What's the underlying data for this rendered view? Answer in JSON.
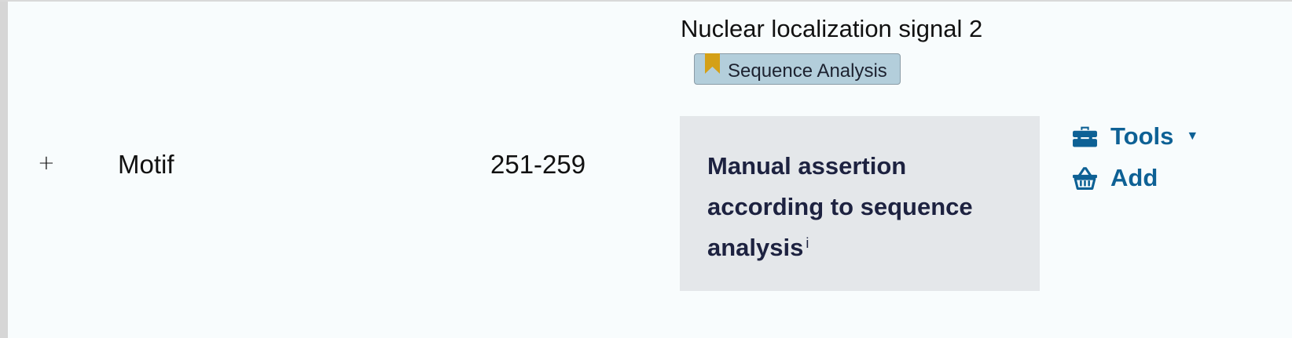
{
  "row": {
    "expand_symbol": "+",
    "type": "Motif",
    "position": "251-259",
    "description": {
      "title": "Nuclear localization signal 2",
      "tag": {
        "label": "Sequence Analysis",
        "icon": "bookmark-icon",
        "icon_color": "#d4a017"
      }
    },
    "evidence": {
      "text": "Manual assertion according to sequence analysis",
      "info_marker": "i"
    },
    "actions": {
      "tools_label": "Tools",
      "tools_icon": "toolbox-icon",
      "dropdown_caret": "▼",
      "add_label": "Add",
      "add_icon": "basket-icon",
      "color": "#0e6195"
    }
  },
  "colors": {
    "row_background": "#f8fcfd",
    "tag_background": "#b3cedb",
    "evidence_background": "#e4e7ea",
    "evidence_text": "#1d2240"
  }
}
